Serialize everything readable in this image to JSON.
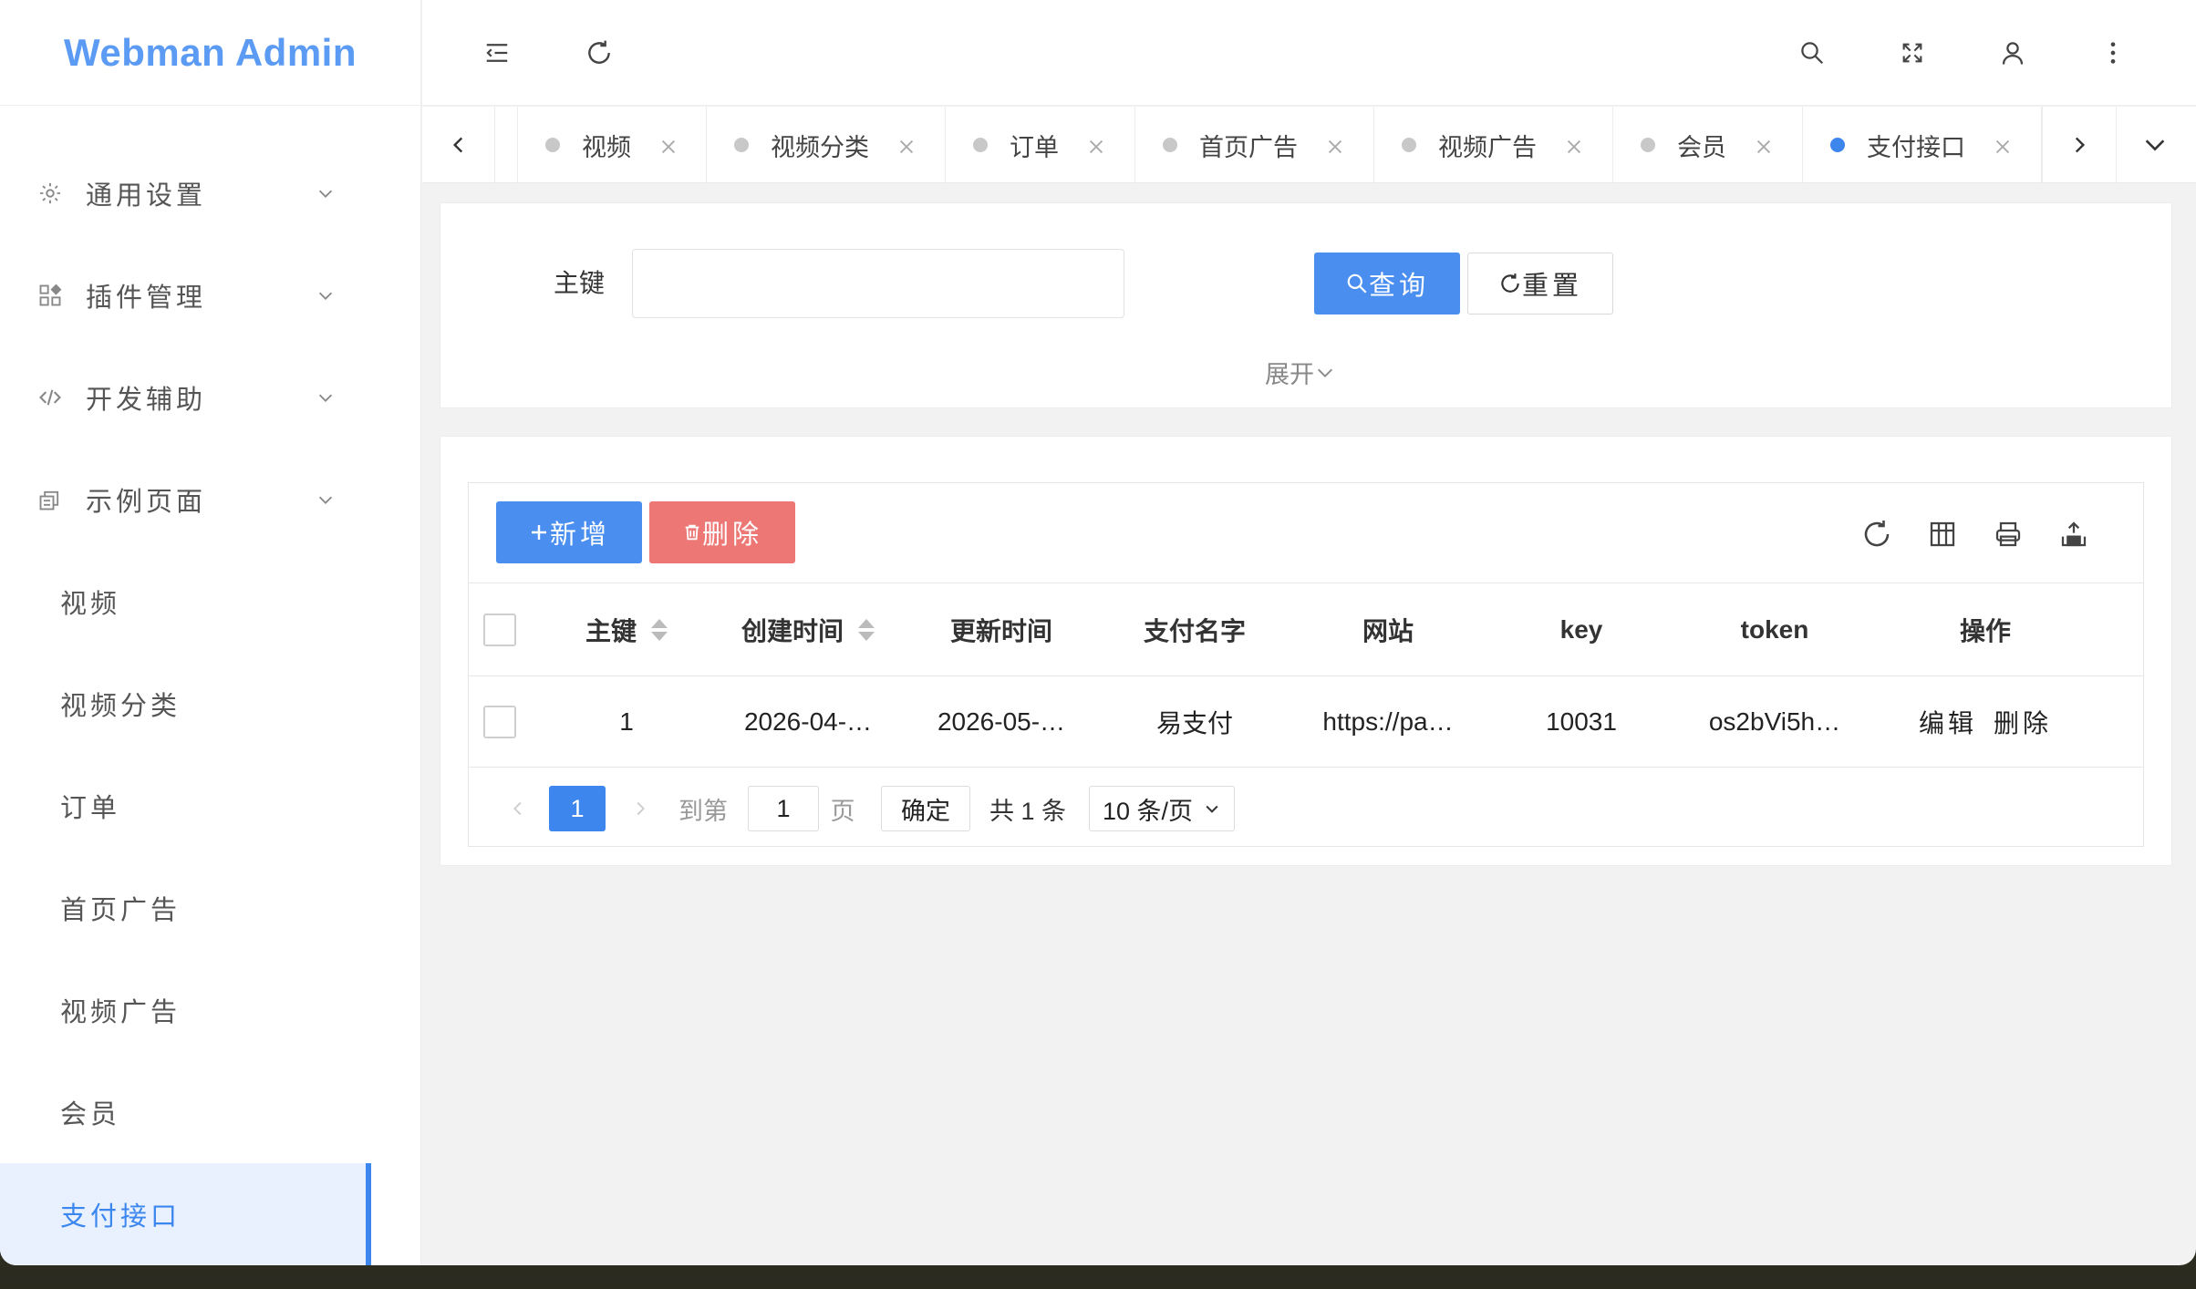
{
  "app": {
    "title": "Webman Admin"
  },
  "sidebar": {
    "groups": [
      {
        "label": "通用设置",
        "icon": "gear-icon"
      },
      {
        "label": "插件管理",
        "icon": "apps-icon"
      },
      {
        "label": "开发辅助",
        "icon": "code-icon"
      },
      {
        "label": "示例页面",
        "icon": "pages-icon"
      }
    ],
    "items": [
      {
        "label": "视频"
      },
      {
        "label": "视频分类"
      },
      {
        "label": "订单"
      },
      {
        "label": "首页广告"
      },
      {
        "label": "视频广告"
      },
      {
        "label": "会员"
      },
      {
        "label": "支付接口",
        "active": true
      }
    ]
  },
  "tabs": [
    {
      "label": "视频"
    },
    {
      "label": "视频分类"
    },
    {
      "label": "订单"
    },
    {
      "label": "首页广告"
    },
    {
      "label": "视频广告"
    },
    {
      "label": "会员"
    },
    {
      "label": "支付接口",
      "active": true
    }
  ],
  "search": {
    "field_label": "主键",
    "field_value": "",
    "query_label": "查询",
    "reset_label": "重置",
    "expand_label": "展开"
  },
  "toolbar": {
    "add_label": "新增",
    "delete_label": "删除"
  },
  "table": {
    "columns": [
      "主键",
      "创建时间",
      "更新时间",
      "支付名字",
      "网站",
      "key",
      "token",
      "操作"
    ],
    "rows": [
      {
        "id": "1",
        "created": "2026-04-…",
        "updated": "2026-05-…",
        "name": "易支付",
        "site": "https://pa…",
        "key": "10031",
        "token": "os2bVi5h…",
        "edit_label": "编辑",
        "delete_label": "删除"
      }
    ]
  },
  "pagination": {
    "current_page": "1",
    "goto_prefix": "到第",
    "goto_value": "1",
    "goto_suffix": "页",
    "confirm_label": "确定",
    "total_text": "共 1 条",
    "page_size": "10 条/页"
  },
  "colors": {
    "primary": "#4a8ff0",
    "danger": "#ec7774",
    "brand": "#5b9bf3",
    "active_bg": "#e8f1fd"
  }
}
